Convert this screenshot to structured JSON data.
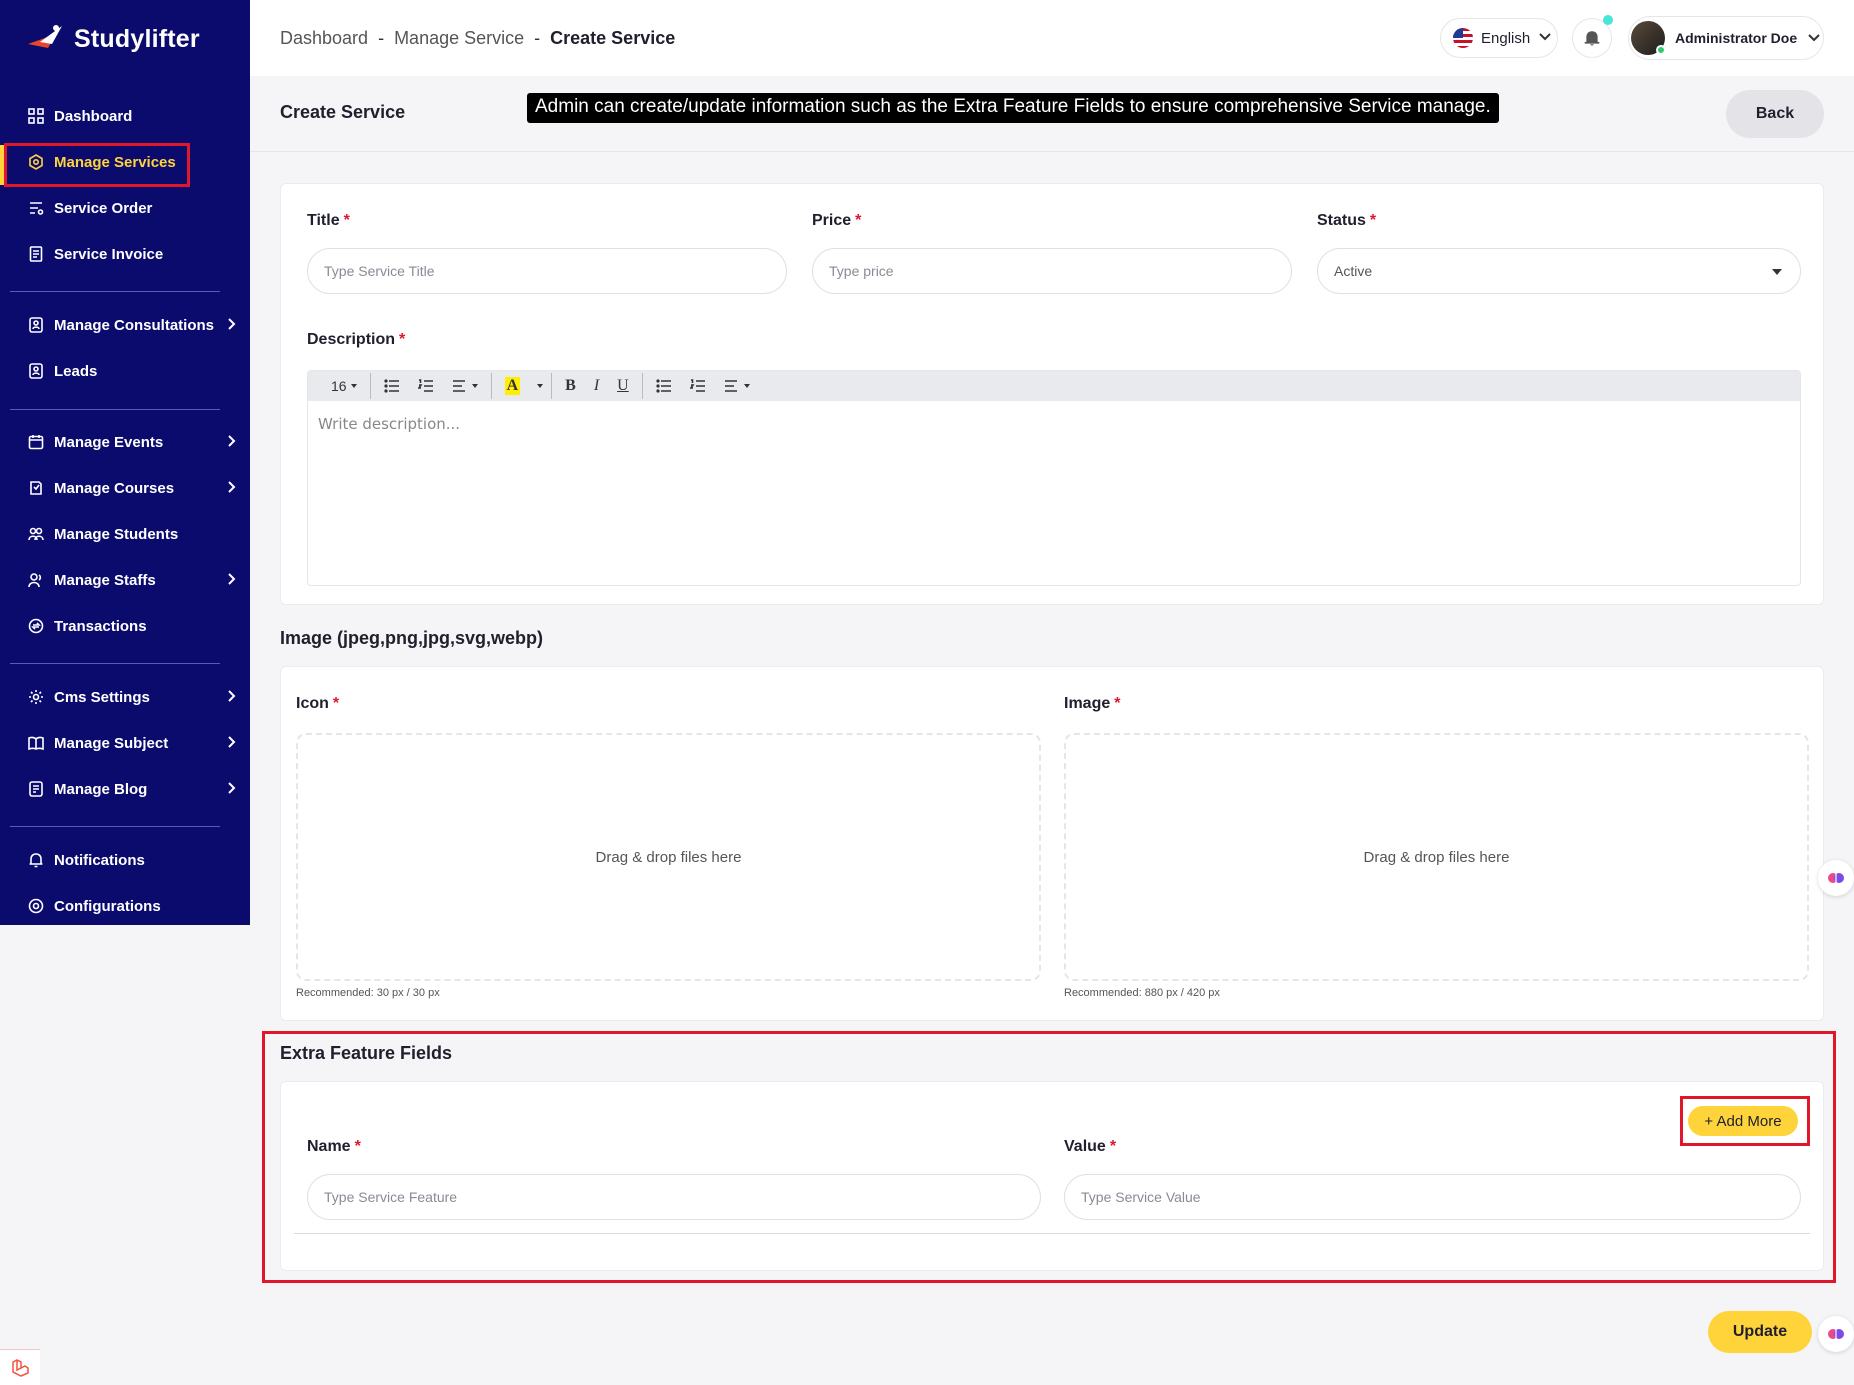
{
  "brand": {
    "name": "Studylifter"
  },
  "sidebar": {
    "items": [
      {
        "label": "Dashboard",
        "icon": "grid-icon",
        "chevron": false
      },
      {
        "label": "Manage Services",
        "icon": "settings-hex-icon",
        "chevron": false,
        "active": true
      },
      {
        "label": "Service Order",
        "icon": "list-filter-icon",
        "chevron": false
      },
      {
        "label": "Service Invoice",
        "icon": "invoice-icon",
        "chevron": false
      },
      {
        "label": "Manage Consultations",
        "icon": "consultation-icon",
        "chevron": true
      },
      {
        "label": "Leads",
        "icon": "leads-icon",
        "chevron": false
      },
      {
        "label": "Manage Events",
        "icon": "calendar-icon",
        "chevron": true
      },
      {
        "label": "Manage Courses",
        "icon": "course-icon",
        "chevron": true
      },
      {
        "label": "Manage Students",
        "icon": "students-icon",
        "chevron": false
      },
      {
        "label": "Manage Staffs",
        "icon": "staff-icon",
        "chevron": true
      },
      {
        "label": "Transactions",
        "icon": "transactions-icon",
        "chevron": false
      },
      {
        "label": "Cms Settings",
        "icon": "cms-icon",
        "chevron": true
      },
      {
        "label": "Manage Subject",
        "icon": "book-icon",
        "chevron": true
      },
      {
        "label": "Manage Blog",
        "icon": "blog-icon",
        "chevron": true
      },
      {
        "label": "Notifications",
        "icon": "bell-icon",
        "chevron": false
      },
      {
        "label": "Configurations",
        "icon": "config-icon",
        "chevron": false
      }
    ]
  },
  "header": {
    "breadcrumb": [
      "Dashboard",
      "Manage Service",
      "Create Service"
    ],
    "breadcrumb_sep": "-",
    "language": "English",
    "user_name": "Administrator Doe"
  },
  "page": {
    "title": "Create Service",
    "tooltip": "Admin can create/update information such as the Extra Feature Fields to ensure comprehensive Service manage.",
    "back_label": "Back"
  },
  "form": {
    "title_label": "Title",
    "title_placeholder": "Type Service Title",
    "price_label": "Price",
    "price_placeholder": "Type price",
    "status_label": "Status",
    "status_value": "Active",
    "description_label": "Description",
    "font_size": "16",
    "description_placeholder": "Write description...",
    "required_mark": "*"
  },
  "images": {
    "section_title": "Image (jpeg,png,jpg,svg,webp)",
    "icon_label": "Icon",
    "image_label": "Image",
    "dropzone_text": "Drag & drop files here",
    "icon_hint": "Recommended: 30 px / 30 px",
    "image_hint": "Recommended: 880 px / 420 px"
  },
  "extra": {
    "section_title": "Extra Feature Fields",
    "add_more_label": "+ Add More",
    "name_label": "Name",
    "name_placeholder": "Type Service Feature",
    "value_label": "Value",
    "value_placeholder": "Type Service Value"
  },
  "actions": {
    "update_label": "Update"
  },
  "colors": {
    "sidebar_bg": "#0b0b6e",
    "accent": "#ffd43b",
    "highlight": "#e0162b"
  }
}
